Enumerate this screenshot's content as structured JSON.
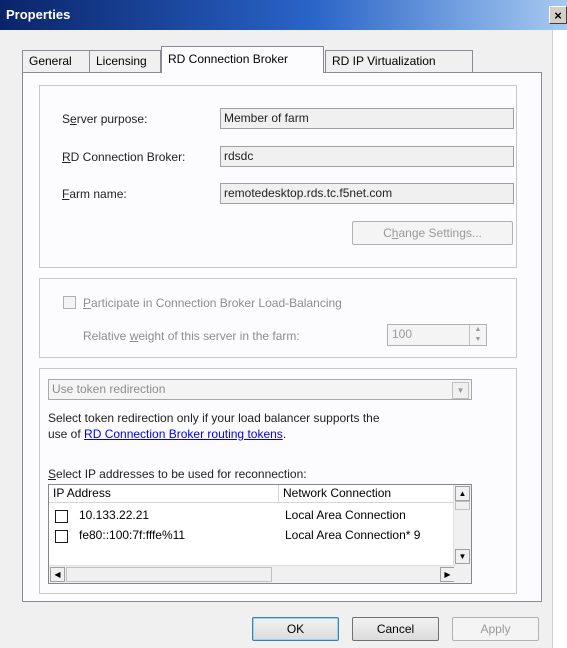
{
  "window": {
    "title": "Properties",
    "close": "×"
  },
  "tabs": [
    "General",
    "Licensing",
    "RD Connection Broker",
    "RD IP Virtualization"
  ],
  "broker": {
    "server_purpose_label_pre": "S",
    "server_purpose_label_u": "e",
    "server_purpose_label_post": "rver purpose:",
    "server_purpose_value": "Member of farm",
    "broker_label_u": "R",
    "broker_label_post": "D Connection Broker:",
    "broker_value": "rdsdc",
    "farm_label_u": "F",
    "farm_label_post": "arm name:",
    "farm_value": "remotedesktop.rds.tc.f5net.com",
    "change_pre": "C",
    "change_u": "h",
    "change_post": "ange Settings..."
  },
  "loadbal": {
    "participate_u": "P",
    "participate_post": "articipate in Connection Broker Load-Balancing",
    "weight_pre": "Relative ",
    "weight_u": "w",
    "weight_post": "eight of this server in the farm:",
    "weight_value": "100"
  },
  "redirect": {
    "combo_value": "Use token redirection",
    "desc_line1": "Select token redirection only if your load balancer supports the",
    "desc_line2_pre": "use of ",
    "desc_link": "RD Connection Broker routing tokens",
    "desc_line2_post": ".",
    "select_u": "S",
    "select_post": "elect IP addresses to be used for reconnection:",
    "columns": [
      "IP Address",
      "Network Connection"
    ],
    "rows": [
      {
        "ip": "10.133.22.21",
        "conn": "Local Area Connection"
      },
      {
        "ip": "fe80::100:7f:fffe%11",
        "conn": "Local Area Connection* 9"
      }
    ]
  },
  "buttons": {
    "ok": "OK",
    "cancel": "Cancel",
    "apply": "Apply"
  }
}
